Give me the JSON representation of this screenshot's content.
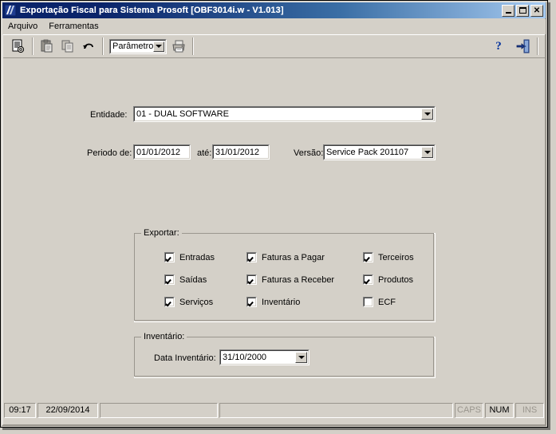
{
  "window": {
    "title": "Exportação Fiscal para Sistema Prosoft [OBF3014i.w - V1.013]",
    "icon": "app-document-icon",
    "minimize_label": "",
    "maximize_label": "",
    "close_label": "✕"
  },
  "menu": {
    "items": [
      {
        "label": "Arquivo"
      },
      {
        "label": "Ferramentas"
      }
    ]
  },
  "toolbar": {
    "buttons": [
      {
        "name": "report-settings-icon",
        "label": ""
      },
      {
        "name": "paste-icon",
        "label": ""
      },
      {
        "name": "copy-icon",
        "label": ""
      },
      {
        "name": "undo-icon",
        "label": ""
      },
      {
        "name": "print-icon",
        "label": ""
      }
    ],
    "combo": {
      "value": "Parâmetros",
      "options": [
        "Parâmetros"
      ]
    },
    "help_label": "?",
    "exit_label": ""
  },
  "form": {
    "entidade": {
      "label": "Entidade:",
      "value": "01 - DUAL SOFTWARE",
      "options": [
        "01 - DUAL SOFTWARE"
      ]
    },
    "periodo": {
      "label": "Periodo de:",
      "from": "01/01/2012",
      "to_label": "até:",
      "to": "31/01/2012"
    },
    "versao": {
      "label": "Versão:",
      "value": "Service Pack 201107",
      "options": [
        "Service Pack 201107"
      ]
    },
    "exportar": {
      "title": "Exportar:",
      "checkboxes": [
        {
          "label": "Entradas",
          "checked": true,
          "col": 0,
          "row": 0
        },
        {
          "label": "Saídas",
          "checked": true,
          "col": 0,
          "row": 1
        },
        {
          "label": "Serviços",
          "checked": true,
          "col": 0,
          "row": 2
        },
        {
          "label": "Faturas a Pagar",
          "checked": true,
          "col": 1,
          "row": 0
        },
        {
          "label": "Faturas a Receber",
          "checked": true,
          "col": 1,
          "row": 1
        },
        {
          "label": "Inventário",
          "checked": true,
          "col": 1,
          "row": 2
        },
        {
          "label": "Terceiros",
          "checked": true,
          "col": 2,
          "row": 0
        },
        {
          "label": "Produtos",
          "checked": true,
          "col": 2,
          "row": 1
        },
        {
          "label": "ECF",
          "checked": false,
          "col": 2,
          "row": 2
        }
      ]
    },
    "inventario": {
      "title": "Inventário:",
      "data_label": "Data Inventário:",
      "data_value": "31/10/2000",
      "options": [
        "31/10/2000"
      ]
    }
  },
  "status_bar": {
    "time": "09:17",
    "date": "22/09/2014",
    "message_1": "",
    "message_2": "",
    "indicators": [
      {
        "label": "CAPS",
        "active": false
      },
      {
        "label": "NUM",
        "active": true
      },
      {
        "label": "INS",
        "active": false
      }
    ]
  },
  "colors": {
    "face": "#d4d0c8",
    "title_dark": "#0a246a",
    "title_light": "#a6caf0",
    "accent_blue": "#00309c",
    "text": "#000000",
    "disabled_text": "#9a968e"
  }
}
